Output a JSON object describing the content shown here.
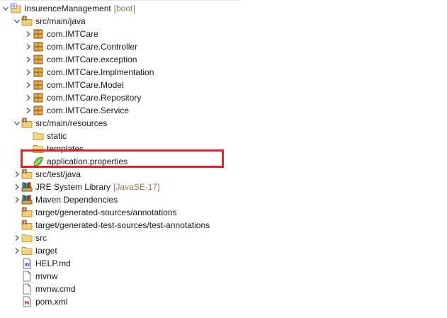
{
  "tree": {
    "rows": [
      {
        "id": "project",
        "level": 0,
        "chev": "down",
        "icon": "project-icon",
        "label": "InsurenceManagement",
        "decoration": "[boot]"
      },
      {
        "id": "src-main-java",
        "level": 1,
        "chev": "down",
        "icon": "source-folder-icon",
        "label": "src/main/java"
      },
      {
        "id": "pkg-imtcare",
        "level": 2,
        "chev": "right",
        "icon": "package-icon",
        "label": "com.IMTCare"
      },
      {
        "id": "pkg-controller",
        "level": 2,
        "chev": "right",
        "icon": "package-icon",
        "label": "com.IMTCare.Controller"
      },
      {
        "id": "pkg-exception",
        "level": 2,
        "chev": "right",
        "icon": "package-icon",
        "label": "com.IMTCare.exception"
      },
      {
        "id": "pkg-implmentation",
        "level": 2,
        "chev": "right",
        "icon": "package-icon",
        "label": "com.IMTCare.Implmentation"
      },
      {
        "id": "pkg-model",
        "level": 2,
        "chev": "right",
        "icon": "package-icon",
        "label": "com.IMTCare.Model"
      },
      {
        "id": "pkg-repository",
        "level": 2,
        "chev": "right",
        "icon": "package-icon",
        "label": "com.IMTCare.Repository"
      },
      {
        "id": "pkg-service",
        "level": 2,
        "chev": "right",
        "icon": "package-icon",
        "label": "com.IMTCare.Service"
      },
      {
        "id": "src-main-resources",
        "level": 1,
        "chev": "down",
        "icon": "source-folder-icon",
        "label": "src/main/resources",
        "selected": true
      },
      {
        "id": "folder-static",
        "level": 2,
        "chev": "none",
        "icon": "folder-icon",
        "label": "static"
      },
      {
        "id": "folder-templates",
        "level": 2,
        "chev": "none",
        "icon": "folder-icon",
        "label": "templates"
      },
      {
        "id": "file-application-properties",
        "level": 2,
        "chev": "none",
        "icon": "spring-leaf-icon",
        "label": "application.properties"
      },
      {
        "id": "src-test-java",
        "level": 1,
        "chev": "right",
        "icon": "source-folder-icon",
        "label": "src/test/java"
      },
      {
        "id": "jre-library",
        "level": 1,
        "chev": "right",
        "icon": "library-icon",
        "label": "JRE System Library",
        "decoration": "[JavaSE-17]"
      },
      {
        "id": "maven-deps",
        "level": 1,
        "chev": "right",
        "icon": "library-icon",
        "label": "Maven Dependencies"
      },
      {
        "id": "gen-sources",
        "level": 1,
        "chev": "none",
        "icon": "source-folder-icon",
        "label": "target/generated-sources/annotations"
      },
      {
        "id": "gen-test-sources",
        "level": 1,
        "chev": "none",
        "icon": "source-folder-icon",
        "label": "target/generated-test-sources/test-annotations"
      },
      {
        "id": "folder-src",
        "level": 1,
        "chev": "right",
        "icon": "folder-icon",
        "label": "src"
      },
      {
        "id": "folder-target",
        "level": 1,
        "chev": "right",
        "icon": "folder-icon",
        "label": "target"
      },
      {
        "id": "file-help",
        "level": 1,
        "chev": "none",
        "icon": "text-file-icon",
        "label": "HELP.md"
      },
      {
        "id": "file-mvnw",
        "level": 1,
        "chev": "none",
        "icon": "file-icon",
        "label": "mvnw"
      },
      {
        "id": "file-mvnw-cmd",
        "level": 1,
        "chev": "none",
        "icon": "file-icon",
        "label": "mvnw.cmd"
      },
      {
        "id": "file-pom",
        "level": 1,
        "chev": "none",
        "icon": "maven-file-icon",
        "label": "pom.xml"
      }
    ]
  },
  "colors": {
    "highlight": "#e0202c",
    "chevron": "#555555",
    "folder": "#e8c46a",
    "package": "#b8860b",
    "leaf": "#6db33f"
  }
}
